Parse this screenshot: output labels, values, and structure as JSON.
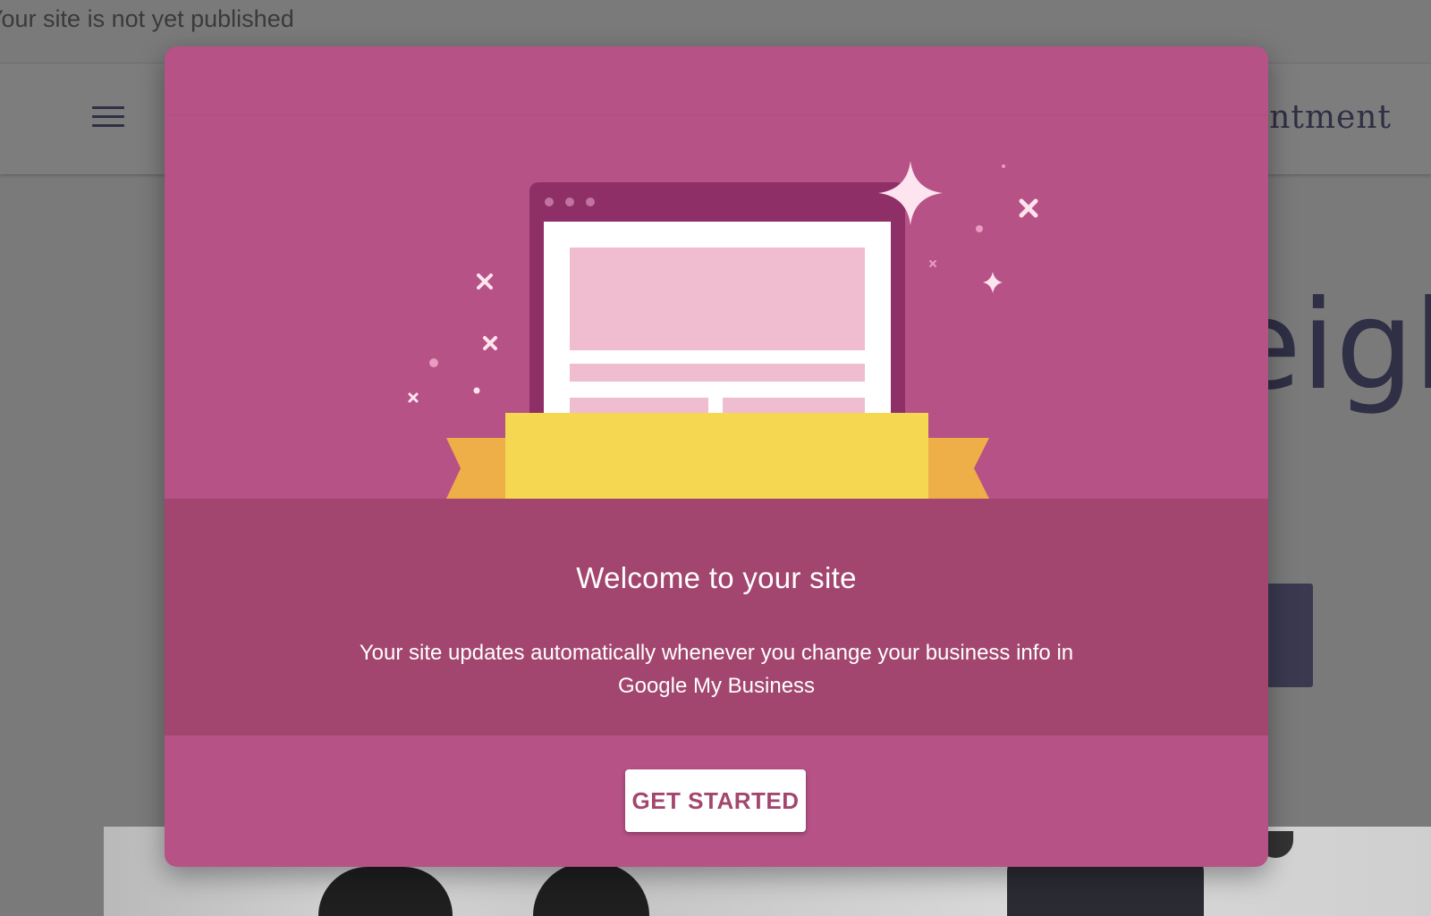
{
  "status_bar": {
    "text": "Your site is not yet published"
  },
  "site_header": {
    "menu_icon": "hamburger-menu-icon",
    "link_text_fragment": "ointment"
  },
  "hero": {
    "headline_fragment": "eigh"
  },
  "modal": {
    "title": "Welcome to your site",
    "description": "Your site updates automatically whenever you change your business info in Google My Business",
    "cta_label": "GET STARTED",
    "illustration": "website-with-banner-and-sparkles",
    "colors": {
      "accent": "#b65286",
      "band": "#a3466f",
      "window_frame": "#8e2f67",
      "content_block": "#f0bcd0",
      "banner": "#f5d752",
      "ribbon": "#eeae48"
    }
  }
}
